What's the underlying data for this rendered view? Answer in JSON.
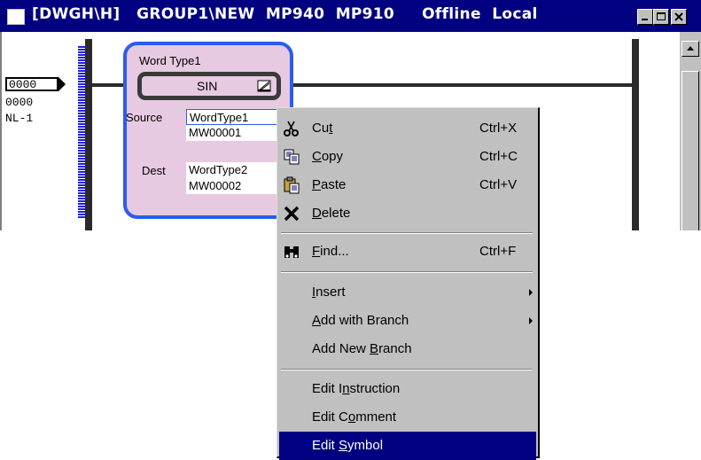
{
  "window": {
    "title": "[DWGH\\H]   GROUP1\\NEW  MP940  MP910     Offline  Local"
  },
  "ladder": {
    "rung_number": "0000",
    "step_number": "0000",
    "nest_label": "NL-1",
    "block": {
      "title": "Word Type1",
      "operator": "SIN",
      "source_label": "Source",
      "source_type": "WordType1",
      "source_register": "MW00001",
      "dest_label": "Dest",
      "dest_type": "WordType2",
      "dest_register": "MW00002"
    }
  },
  "context_menu": {
    "items": [
      {
        "label": "Cut",
        "mnemonic": "t",
        "shortcut": "Ctrl+X",
        "icon": "scissors-icon"
      },
      {
        "label": "Copy",
        "mnemonic": "C",
        "shortcut": "Ctrl+C",
        "icon": "copy-icon"
      },
      {
        "label": "Paste",
        "mnemonic": "P",
        "shortcut": "Ctrl+V",
        "icon": "paste-icon"
      },
      {
        "label": "Delete",
        "mnemonic": "D",
        "shortcut": "",
        "icon": "delete-x-icon"
      },
      {
        "label": "Find...",
        "mnemonic": "F",
        "shortcut": "Ctrl+F",
        "icon": "binoculars-icon"
      },
      {
        "label": "Insert",
        "mnemonic": "I",
        "shortcut": "",
        "submenu": true
      },
      {
        "label": "Add with Branch",
        "mnemonic": "A",
        "shortcut": "",
        "submenu": true
      },
      {
        "label": "Add New Branch",
        "mnemonic": "B",
        "shortcut": ""
      },
      {
        "label": "Edit Instruction",
        "mnemonic": "n",
        "shortcut": ""
      },
      {
        "label": "Edit Comment",
        "mnemonic": "o",
        "shortcut": ""
      },
      {
        "label": "Edit Symbol",
        "mnemonic": "S",
        "shortcut": "",
        "highlighted": true
      }
    ]
  },
  "colors": {
    "titlebar": "#000080",
    "block_fill": "#e7c9e1",
    "block_border": "#2b5cf0",
    "menu_highlight": "#000080"
  }
}
